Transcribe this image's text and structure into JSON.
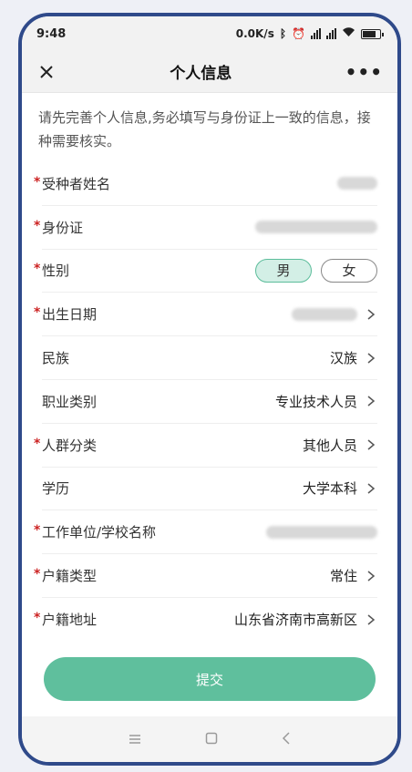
{
  "status": {
    "time": "9:48",
    "speed": "0.0K/s"
  },
  "header": {
    "title": "个人信息"
  },
  "intro": "请先完善个人信息,务必填写与身份证上一致的信息，接种需要核实。",
  "fields": [
    {
      "label": "受种者姓名",
      "required": true,
      "value": "",
      "redacted": true
    },
    {
      "label": "身份证",
      "required": true,
      "value": "",
      "redacted": true
    },
    {
      "label": "性别",
      "required": true,
      "options": [
        "男",
        "女"
      ],
      "selected": "男"
    },
    {
      "label": "出生日期",
      "required": true,
      "value": "",
      "redacted": true,
      "arrow": true
    },
    {
      "label": "民族",
      "required": false,
      "value": "汉族",
      "arrow": true
    },
    {
      "label": "职业类别",
      "required": false,
      "value": "专业技术人员",
      "arrow": true
    },
    {
      "label": "人群分类",
      "required": true,
      "value": "其他人员",
      "arrow": true
    },
    {
      "label": "学历",
      "required": false,
      "value": "大学本科",
      "arrow": true
    },
    {
      "label": "工作单位/学校名称",
      "required": true,
      "value": "",
      "redacted": true
    },
    {
      "label": "户籍类型",
      "required": true,
      "value": "常住",
      "arrow": true
    },
    {
      "label": "户籍地址",
      "required": true,
      "value": "山东省济南市高新区",
      "arrow": true
    }
  ],
  "submit_label": "提交",
  "colors": {
    "accent": "#5fbf9d",
    "required": "#cc2222",
    "frame": "#2f4a8a"
  }
}
